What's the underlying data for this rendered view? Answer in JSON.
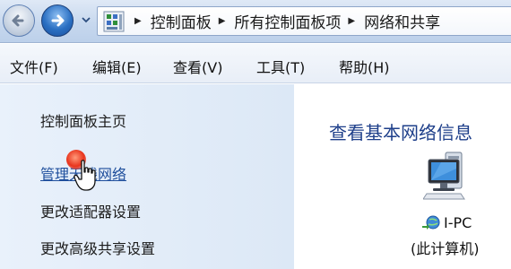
{
  "navbar": {
    "back_icon": "back-arrow-icon",
    "forward_icon": "forward-arrow-icon",
    "address_icon": "control-panel-icon",
    "breadcrumbs": [
      "控制面板",
      "所有控制面板项",
      "网络和共享"
    ]
  },
  "menu": {
    "items": [
      "文件(F)",
      "编辑(E)",
      "查看(V)",
      "工具(T)",
      "帮助(H)"
    ]
  },
  "tasks": {
    "home": "控制面板主页",
    "manage_wireless": "管理无线网络",
    "adapter_settings": "更改适配器设置",
    "advanced_sharing": "更改高级共享设置"
  },
  "main": {
    "title": "查看基本网络信息",
    "computer_name": "I-PC",
    "computer_sub": "(此计算机)"
  },
  "colors": {
    "link_blue": "#1e4e9c",
    "title_blue": "#1e3f8a",
    "click_highlight": "#e8331c"
  }
}
